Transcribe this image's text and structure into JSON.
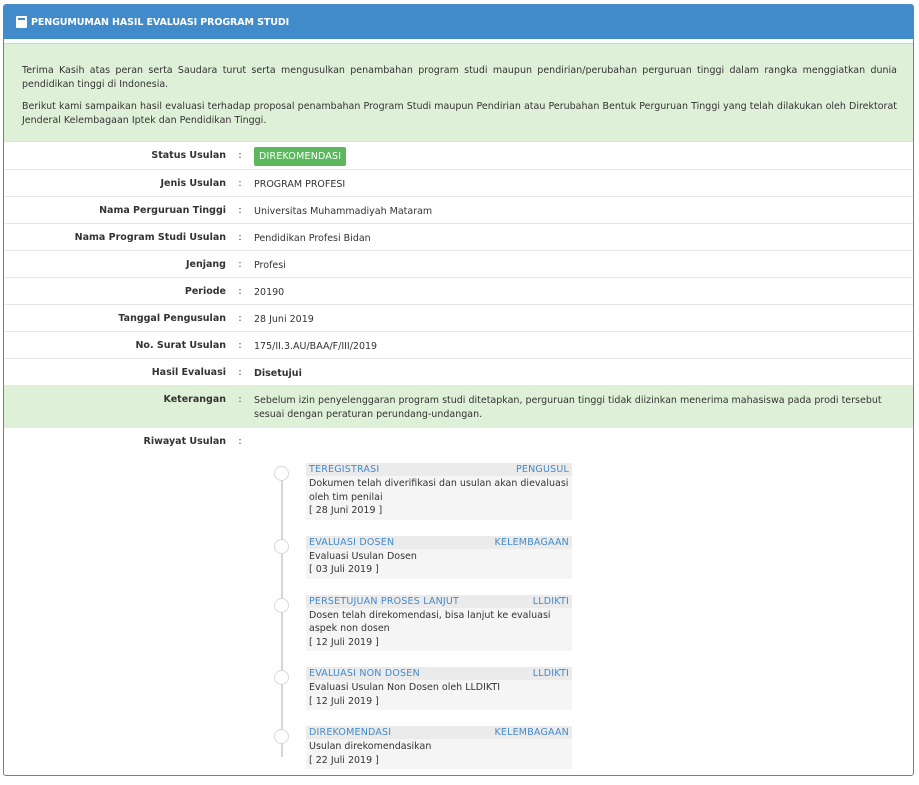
{
  "panel": {
    "title": "PENGUMUMAN HASIL EVALUASI PROGRAM STUDI",
    "intro": [
      "Terima Kasih atas peran serta Saudara turut serta mengusulkan penambahan program studi maupun pendirian/perubahan perguruan tinggi dalam rangka menggiatkan dunia pendidikan tinggi di Indonesia.",
      "Berikut kami sampaikan hasil evaluasi terhadap proposal penambahan Program Studi maupun Pendirian atau Perubahan Bentuk Perguruan Tinggi yang telah dilakukan oleh Direktorat Jenderal Kelembagaan Iptek dan Pendidikan Tinggi."
    ]
  },
  "details": {
    "colon": ":",
    "status": {
      "label": "Status Usulan",
      "value": "DIREKOMENDASI",
      "color": "#5cb85c"
    },
    "jenis": {
      "label": "Jenis Usulan",
      "value": "PROGRAM PROFESI"
    },
    "pt": {
      "label": "Nama Perguruan Tinggi",
      "value": "Universitas Muhammadiyah Mataram"
    },
    "prodi": {
      "label": "Nama Program Studi Usulan",
      "value": "Pendidikan Profesi Bidan"
    },
    "jenjang": {
      "label": "Jenjang",
      "value": "Profesi"
    },
    "periode": {
      "label": "Periode",
      "value": "20190"
    },
    "tanggal": {
      "label": "Tanggal Pengusulan",
      "value": "28 Juni 2019"
    },
    "surat": {
      "label": "No. Surat Usulan",
      "value": "175/II.3.AU/BAA/F/III/2019"
    },
    "hasil": {
      "label": "Hasil Evaluasi",
      "value": "Disetujui"
    },
    "keterangan": {
      "label": "Keterangan",
      "value": "Sebelum izin penyelenggaran program studi ditetapkan, perguruan tinggi tidak diizinkan menerima mahasiswa pada prodi tersebut sesuai dengan peraturan perundang-undangan."
    },
    "riwayat": {
      "label": "Riwayat Usulan"
    }
  },
  "timeline": [
    {
      "stage": "TEREGISTRASI",
      "actor": "PENGUSUL",
      "desc": "Dokumen telah diverifikasi dan usulan akan dievaluasi oleh tim penilai",
      "date": "[ 28 Juni 2019 ]"
    },
    {
      "stage": "EVALUASI DOSEN",
      "actor": "KELEMBAGAAN",
      "desc": "Evaluasi Usulan Dosen",
      "date": "[ 03 Juli 2019 ]"
    },
    {
      "stage": "PERSETUJUAN PROSES LANJUT",
      "actor": "LLDIKTI",
      "desc": "Dosen telah direkomendasi, bisa lanjut ke evaluasi aspek non dosen",
      "date": "[ 12 Juli 2019 ]"
    },
    {
      "stage": "EVALUASI NON DOSEN",
      "actor": "LLDIKTI",
      "desc": "Evaluasi Usulan Non Dosen oleh LLDIKTI",
      "date": "[ 12 Juli 2019 ]"
    },
    {
      "stage": "DIREKOMENDASI",
      "actor": "KELEMBAGAAN",
      "desc": "Usulan direkomendasikan",
      "date": "[ 22 Juli 2019 ]"
    }
  ],
  "colors": {
    "header": "#428bca",
    "success": "#5cb85c",
    "highlight": "#dff0d8"
  }
}
